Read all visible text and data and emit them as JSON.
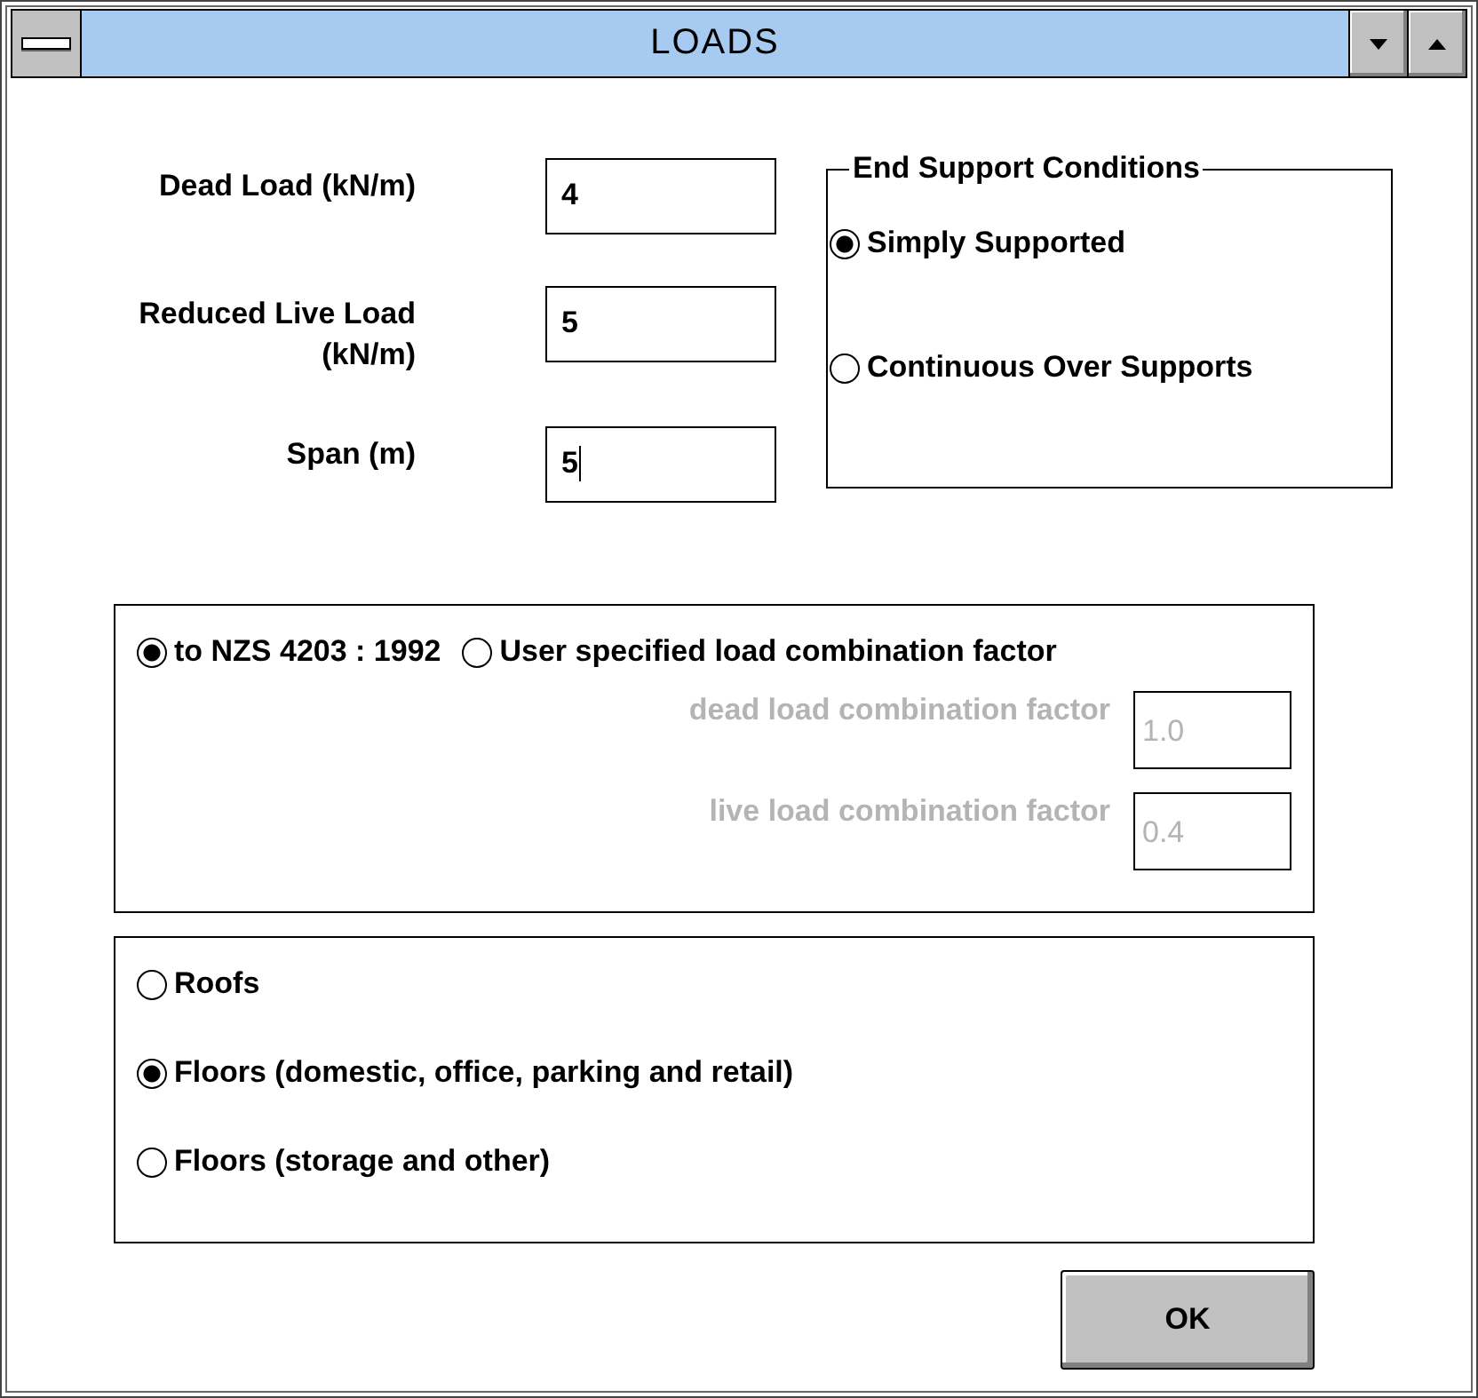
{
  "window": {
    "title": "LOADS"
  },
  "fields": [
    {
      "label": "Dead Load (kN/m)",
      "value": "4",
      "focused": false
    },
    {
      "label": "Reduced Live Load\n(kN/m)",
      "value": "5",
      "focused": false
    },
    {
      "label": "Span (m)",
      "value": "5",
      "focused": true
    }
  ],
  "end_support": {
    "title": "End Support Conditions",
    "options": [
      {
        "label": "Simply Supported",
        "selected": true
      },
      {
        "label": "Continuous Over Supports",
        "selected": false
      }
    ]
  },
  "combination": {
    "options": [
      {
        "label": "to NZS 4203 : 1992",
        "selected": true
      },
      {
        "label": "User specified load combination factor",
        "selected": false
      }
    ],
    "factors": [
      {
        "label": "dead load combination factor",
        "value": "1.0",
        "disabled": true
      },
      {
        "label": "live load combination factor",
        "value": "0.4",
        "disabled": true
      }
    ]
  },
  "occupancy": {
    "options": [
      {
        "label": "Roofs",
        "selected": false
      },
      {
        "label": "Floors (domestic, office, parking and retail)",
        "selected": true
      },
      {
        "label": "Floors (storage and other)",
        "selected": false
      }
    ]
  },
  "buttons": [
    {
      "label": "OK"
    }
  ]
}
